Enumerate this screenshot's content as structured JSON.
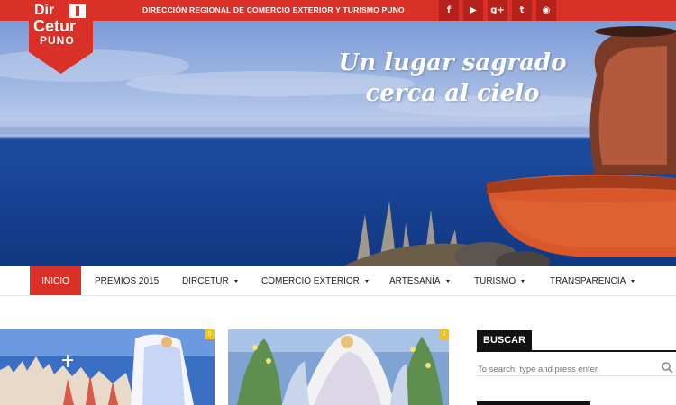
{
  "topbar": {
    "title": "DIRECCIÓN REGIONAL DE COMERCIO EXTERIOR Y TURISMO  PUNO",
    "social": [
      {
        "icon": "facebook-icon",
        "glyph": "f"
      },
      {
        "icon": "youtube-icon",
        "glyph": "▶"
      },
      {
        "icon": "google-plus-icon",
        "glyph": "g+"
      },
      {
        "icon": "twitter-icon",
        "glyph": "t"
      },
      {
        "icon": "rss-icon",
        "glyph": "◉"
      }
    ]
  },
  "logo": {
    "line1": "Dir",
    "line2": "Cetur",
    "line3": "PUNO"
  },
  "hero": {
    "slogan_line1": "Un lugar sagrado",
    "slogan_line2": "cerca al cielo"
  },
  "nav": {
    "items": [
      {
        "label": "INICIO",
        "active": true
      },
      {
        "label": "PREMIOS 2015"
      },
      {
        "label": "DIRCETUR",
        "dropdown": true
      },
      {
        "label": "COMERCIO EXTERIOR",
        "dropdown": true
      },
      {
        "label": "ARTESANÍA",
        "dropdown": true
      },
      {
        "label": "TURISMO",
        "dropdown": true
      },
      {
        "label": "TRANSPARENCIA",
        "dropdown": true
      }
    ]
  },
  "posts": [
    {
      "comments": "0"
    },
    {
      "comments": "0"
    }
  ],
  "sidebar": {
    "search_title": "BUSCAR",
    "search_placeholder": "To search, type and press enter."
  },
  "colors": {
    "brand_red": "#d93128",
    "badge_yellow": "#f2c21a"
  }
}
